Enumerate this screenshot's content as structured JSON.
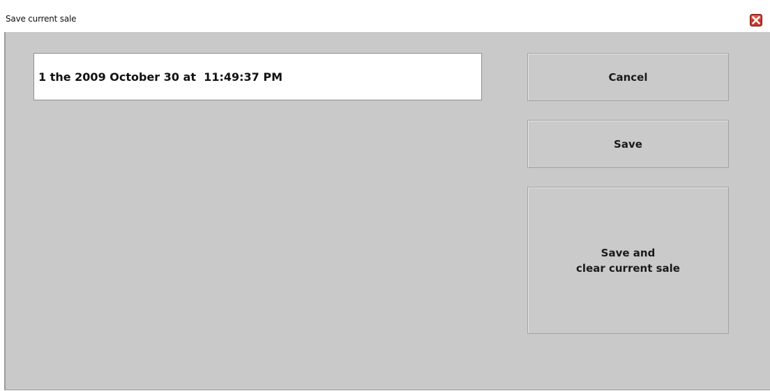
{
  "window": {
    "title": "Save current sale",
    "close_icon": "close-icon",
    "close_color": "#c0392b"
  },
  "form": {
    "sale_name_value": "1 the 2009 October 30 at  11:49:37 PM"
  },
  "buttons": {
    "cancel_label": "Cancel",
    "save_label": "Save",
    "save_clear_line1": "Save and",
    "save_clear_line2": "clear current sale"
  }
}
